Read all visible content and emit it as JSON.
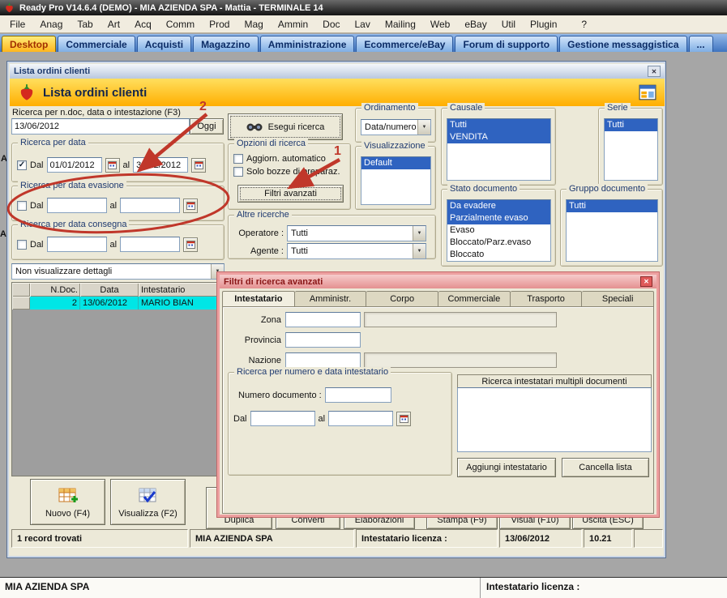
{
  "icons": {
    "close": "✕",
    "dropdown": "▼",
    "check": "✓"
  },
  "colors": {
    "selection_blue": "#2f63c0",
    "row_cyan": "#00e6e6",
    "tab_yellow": "#ffd535",
    "annotation_red": "#c0372a",
    "header_orange": "#ffae00"
  },
  "titlebar": {
    "title": "Ready Pro V14.6.4 (DEMO)  - MIA AZIENDA SPA - Mattia - TERMINALE 14"
  },
  "menubar": {
    "items": [
      "File",
      "Anag",
      "Tab",
      "Art",
      "Acq",
      "Comm",
      "Prod",
      "Mag",
      "Ammin",
      "Doc",
      "Lav",
      "Mailing",
      "Web",
      "eBay",
      "Util",
      "Plugin",
      "?"
    ]
  },
  "tabbar": {
    "tabs": [
      "Desktop",
      "Commerciale",
      "Acquisti",
      "Magazzino",
      "Amministrazione",
      "Ecommerce/eBay",
      "Forum di supporto",
      "Gestione messaggistica",
      "..."
    ]
  },
  "left_edge": {
    "labels": [
      "A",
      "A"
    ]
  },
  "win": {
    "title": "Lista ordini clienti",
    "header": "Lista ordini clienti",
    "search_label": "Ricerca per n.doc, data o intestazione (F3)",
    "search_value": "13/06/2012",
    "oggi": "Oggi",
    "esegui": "Esegui ricerca",
    "grp_data": {
      "title": "Ricerca per data",
      "dal": "Dal",
      "al": "al",
      "from": "01/01/2012",
      "to": "31/12/2012"
    },
    "grp_evasione": {
      "title": "Ricerca per data evasione",
      "dal": "Dal",
      "al": "al",
      "from": "",
      "to": ""
    },
    "grp_consegna": {
      "title": "Ricerca per data consegna",
      "dal": "Dal",
      "al": "al",
      "from": "",
      "to": ""
    },
    "opzioni": {
      "title": "Opzioni di ricerca",
      "cb_auto": "Aggiorn. automatico",
      "cb_bozze": "Solo bozze di preparaz.",
      "filtri": "Filtri avanzati"
    },
    "ordinamento": {
      "title": "Ordinamento",
      "value": "Data/numero"
    },
    "visualizzazione": {
      "title": "Visualizzazione",
      "items": [
        "Default"
      ]
    },
    "altre": {
      "title": "Altre ricerche",
      "operatore_label": "Operatore :",
      "operatore_value": "Tutti",
      "agente_label": "Agente :",
      "agente_value": "Tutti"
    },
    "causale": {
      "title": "Causale",
      "items": [
        "Tutti",
        "VENDITA"
      ]
    },
    "serie": {
      "title": "Serie",
      "items": [
        "Tutti"
      ]
    },
    "stato": {
      "title": "Stato documento",
      "items": [
        "Da evadere",
        "Parzialmente evaso",
        "Evaso",
        "Bloccato/Parz.evaso",
        "Bloccato"
      ]
    },
    "gruppo": {
      "title": "Gruppo documento",
      "items": [
        "Tutti"
      ]
    },
    "dettagli_value": "Non visualizzare dettagli",
    "table": {
      "headers": [
        "N.Doc.",
        "Data",
        "Intestatario"
      ],
      "row": {
        "ndoc": "2",
        "data": "13/06/2012",
        "intestatario": "MARIO BIAN"
      }
    },
    "buttons": {
      "nuovo": "Nuovo (F4)",
      "visualizza": "Visualizza (F2)",
      "duplica": "Duplica",
      "converti": "Converti",
      "elaborazioni": "Elaborazioni",
      "stampa": "Stampa (F9)",
      "visual": "Visual (F10)",
      "uscita": "Uscita (ESC)"
    },
    "statusbar": {
      "records": "1 record trovati",
      "azienda": "MIA AZIENDA SPA",
      "licenza": "Intestatario licenza :",
      "data": "13/06/2012",
      "ora": "10.21"
    }
  },
  "dialog": {
    "title": "Filtri di ricerca avanzati",
    "tabs": [
      "Intestatario",
      "Amministr.",
      "Corpo",
      "Commerciale",
      "Trasporto",
      "Speciali"
    ],
    "zona": "Zona",
    "provincia": "Provincia",
    "nazione": "Nazione",
    "grp_numero": "Ricerca per numero e data intestatario",
    "numero_doc": "Numero documento :",
    "dal": "Dal",
    "al": "al",
    "multipli": "Ricerca intestatari multipli documenti",
    "aggiungi": "Aggiungi intestatario",
    "cancella": "Cancella lista"
  },
  "footer": {
    "azienda": "MIA AZIENDA SPA",
    "licenza": "Intestatario licenza :"
  },
  "annotations": {
    "label1": "1",
    "label2": "2",
    "color": "#c0372a"
  }
}
